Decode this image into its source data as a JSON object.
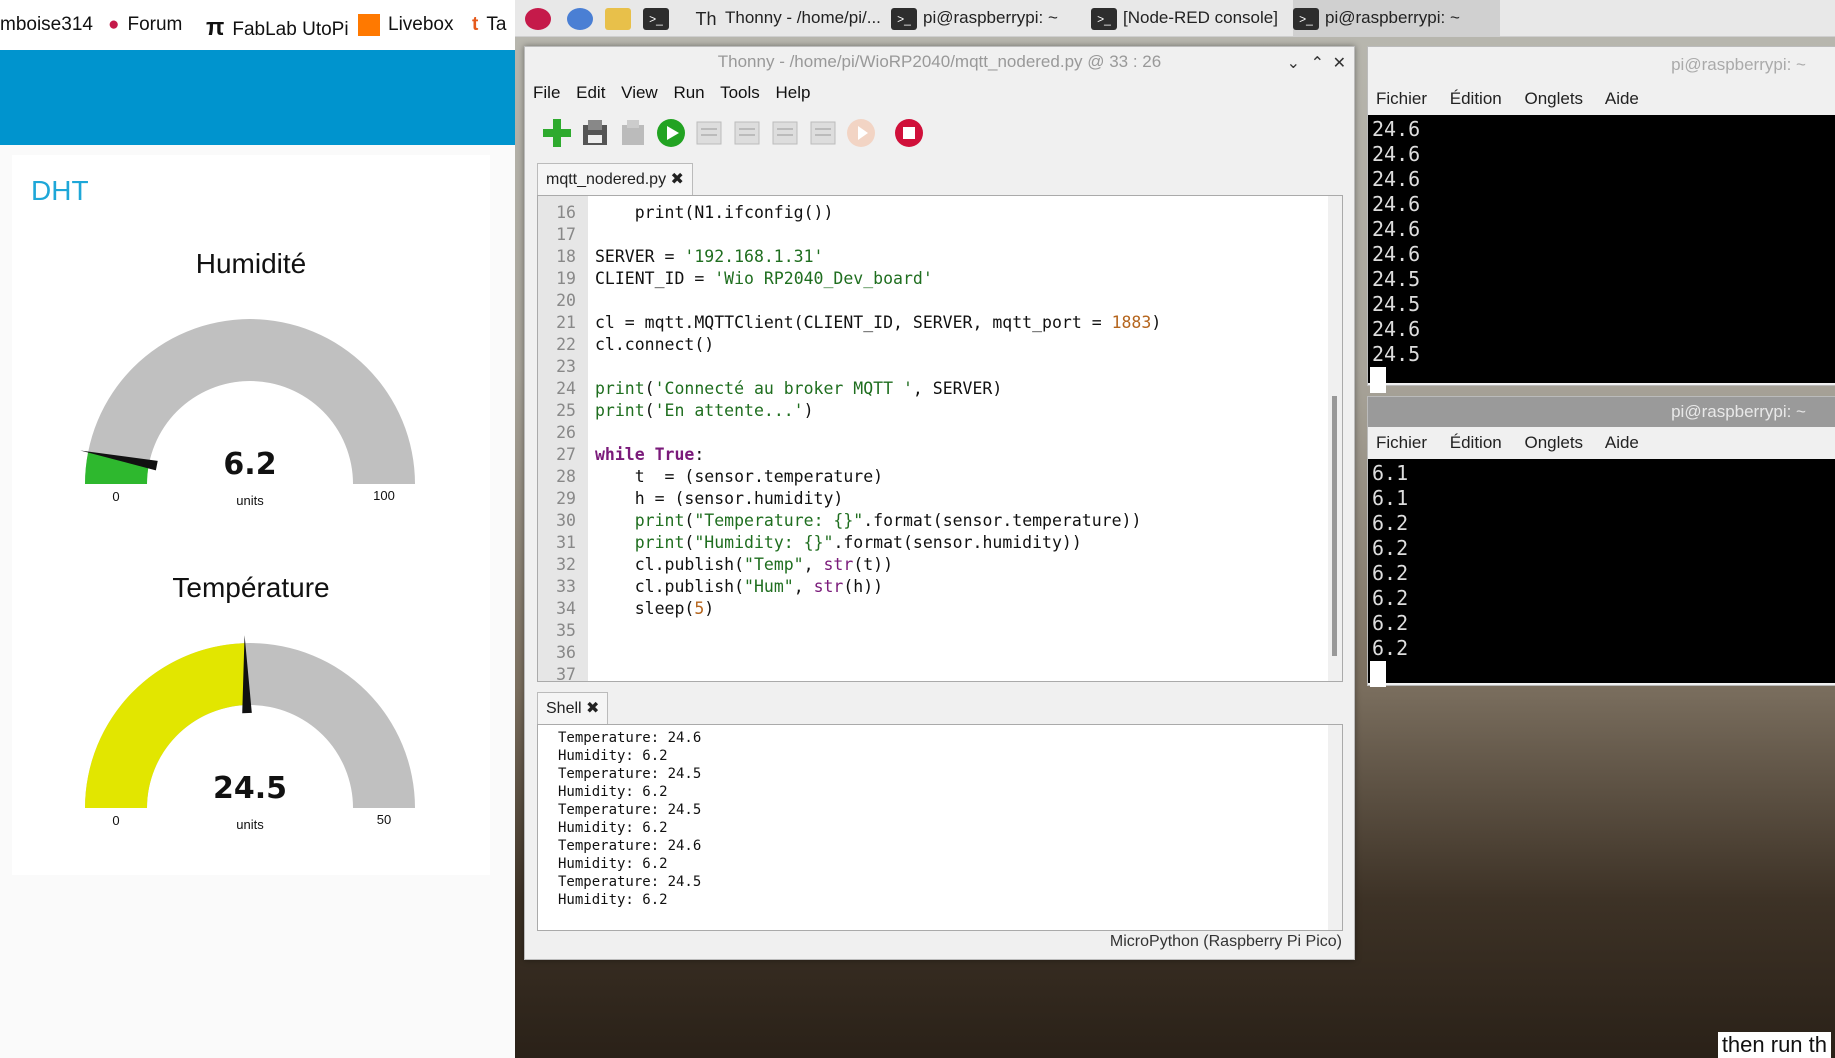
{
  "bookmarks": [
    "mboise314",
    "Forum",
    "FabLab UtoPi",
    "Livebox",
    "Ta"
  ],
  "dashboard": {
    "title": "DHT",
    "humidity": {
      "title": "Humidité",
      "value": "6.2",
      "units": "units",
      "min": "0",
      "max": "100",
      "level": 0.062,
      "color": "#2eb82e"
    },
    "temperature": {
      "title": "Température",
      "value": "24.5",
      "units": "units",
      "min": "0",
      "max": "50",
      "level": 0.49,
      "color": "#e2e600"
    }
  },
  "taskbar": {
    "items": [
      "Thonny  -  /home/pi/...",
      "pi@raspberrypi: ~",
      "[Node-RED console]",
      "pi@raspberrypi: ~"
    ]
  },
  "thonny": {
    "title": "Thonny  -  /home/pi/WioRP2040/mqtt_nodered.py  @  33 : 26",
    "menu": [
      "File",
      "Edit",
      "View",
      "Run",
      "Tools",
      "Help"
    ],
    "tab": "mqtt_nodered.py",
    "shell_tab": "Shell",
    "status": "MicroPython (Raspberry Pi Pico)",
    "code_lines": [
      {
        "n": "16",
        "html": "    print(N1.ifconfig())"
      },
      {
        "n": "17",
        "html": ""
      },
      {
        "n": "18",
        "html": "SERVER = <span class='str'>'192.168.1.31'</span>"
      },
      {
        "n": "19",
        "html": "CLIENT_ID = <span class='str'>'Wio RP2040_Dev_board'</span>"
      },
      {
        "n": "20",
        "html": ""
      },
      {
        "n": "21",
        "html": "cl = mqtt.MQTTClient(CLIENT_ID, SERVER, mqtt_port = <span class='num'>1883</span>)"
      },
      {
        "n": "22",
        "html": "cl.connect()"
      },
      {
        "n": "23",
        "html": ""
      },
      {
        "n": "24",
        "html": "<span class='str'>print</span>(<span class='str'>'Connecté au broker MQTT '</span>, SERVER)"
      },
      {
        "n": "25",
        "html": "<span class='str'>print</span>(<span class='str'>'En attente...'</span>)"
      },
      {
        "n": "26",
        "html": ""
      },
      {
        "n": "27",
        "html": "<span class='kw'>while</span> <span class='kw'>True</span>:"
      },
      {
        "n": "28",
        "html": "    t  = (sensor.temperature)"
      },
      {
        "n": "29",
        "html": "    h = (sensor.humidity)"
      },
      {
        "n": "30",
        "html": "    <span class='str'>print</span>(<span class='str'>\"Temperature: {}\"</span>.format(sensor.temperature))"
      },
      {
        "n": "31",
        "html": "    <span class='str'>print</span>(<span class='str'>\"Humidity: {}\"</span>.format(sensor.humidity))"
      },
      {
        "n": "32",
        "html": "    cl.publish(<span class='str'>\"Temp\"</span>, <span class='kw' style='font-weight:normal'>str</span>(t))"
      },
      {
        "n": "33",
        "html": "    cl.publish(<span class='str'>\"Hum\"</span>, <span class='kw' style='font-weight:normal'>str</span>(h))"
      },
      {
        "n": "34",
        "html": "    sleep(<span class='num'>5</span>)"
      },
      {
        "n": "35",
        "html": ""
      },
      {
        "n": "36",
        "html": ""
      },
      {
        "n": "37",
        "html": ""
      }
    ],
    "shell_lines": [
      "Temperature: 24.6",
      "Humidity: 6.2",
      "Temperature: 24.5",
      "Humidity: 6.2",
      "Temperature: 24.5",
      "Humidity: 6.2",
      "Temperature: 24.6",
      "Humidity: 6.2",
      "Temperature: 24.5",
      "Humidity: 6.2"
    ]
  },
  "terminal1": {
    "title": "pi@raspberrypi: ~",
    "menu": [
      "Fichier",
      "Édition",
      "Onglets",
      "Aide"
    ],
    "lines": [
      "24.6",
      "24.6",
      "24.6",
      "24.6",
      "24.6",
      "24.6",
      "24.5",
      "24.5",
      "24.6",
      "24.5"
    ]
  },
  "terminal2": {
    "title": "pi@raspberrypi: ~",
    "menu": [
      "Fichier",
      "Édition",
      "Onglets",
      "Aide"
    ],
    "lines": [
      "6.1",
      "6.1",
      "6.2",
      "6.2",
      "6.2",
      "6.2",
      "6.2",
      "6.2"
    ]
  },
  "bottom_text": "then run th"
}
